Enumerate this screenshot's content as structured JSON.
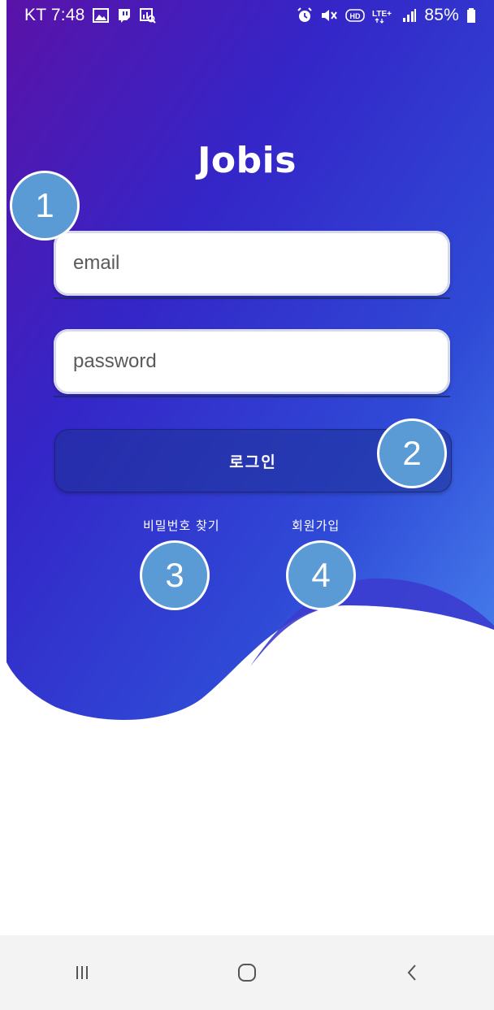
{
  "status_bar": {
    "carrier_time": "KT 7:48",
    "battery": "85%",
    "left_icons": [
      "gallery-icon",
      "twitch-icon",
      "data-saver-icon"
    ],
    "right_icons": [
      "alarm-icon",
      "mute-icon",
      "hd-icon",
      "lte-plus-icon",
      "signal-icon",
      "battery-icon"
    ]
  },
  "app": {
    "title": "Jobis"
  },
  "login_form": {
    "email_placeholder": "email",
    "password_placeholder": "password",
    "login_label": "로그인",
    "find_password_label": "비밀번호 찾기",
    "signup_label": "회원가입"
  },
  "annotations": {
    "marker_1": "1",
    "marker_2": "2",
    "marker_3": "3",
    "marker_4": "4"
  },
  "nav_bar": {
    "icons": [
      "recent-apps-icon",
      "home-icon",
      "back-icon"
    ]
  },
  "colors": {
    "gradient_start": "#5a12a8",
    "gradient_mid": "#2f3fd0",
    "gradient_end": "#4a86f0",
    "marker": "#5b9bd5",
    "nav_bg": "#f3f3f3"
  }
}
